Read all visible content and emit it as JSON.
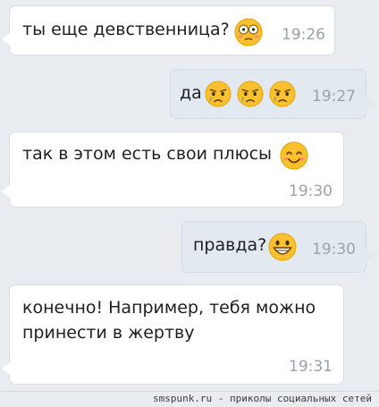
{
  "messages": [
    {
      "text": "ты еще девственница?",
      "time": "19:26",
      "emoji": [
        "flushed-face-icon"
      ]
    },
    {
      "text": "да",
      "time": "19:27",
      "emoji": [
        "sad-tear-face-icon",
        "sad-tear-face-icon",
        "sad-tear-face-icon"
      ]
    },
    {
      "text": "так в этом есть свои плюсы",
      "time": "19:30",
      "emoji": [
        "smiling-face-icon"
      ]
    },
    {
      "text": "правда?",
      "time": "19:30",
      "emoji": [
        "grinning-face-icon"
      ]
    },
    {
      "text_line1": "конечно! Например, тебя можно",
      "text_line2": "принести в жертву",
      "time": "19:31"
    }
  ],
  "footer": {
    "text": "smspunk.ru - приколы социальных сетей"
  },
  "colors": {
    "background": "#e9ecf0",
    "incoming_bubble": "#ffffff",
    "outgoing_bubble": "#e3e9f1",
    "time": "#98a2ad",
    "emoji_yellow": "#fbc02d"
  }
}
